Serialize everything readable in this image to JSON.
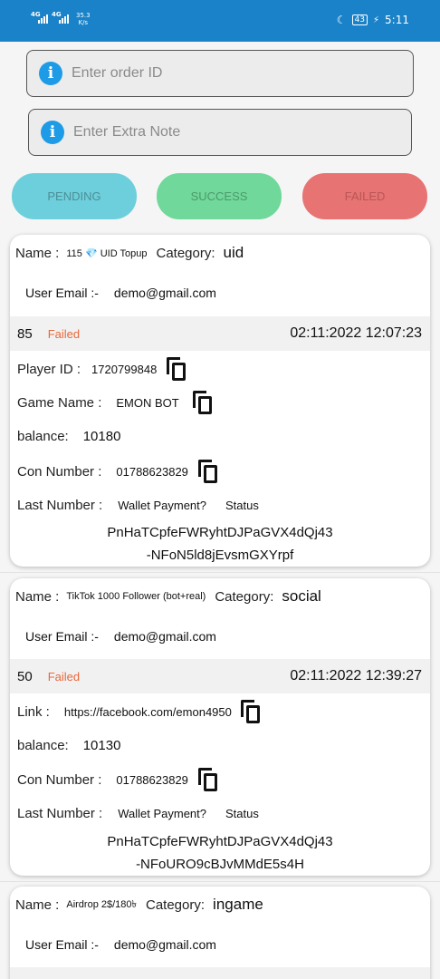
{
  "status_bar": {
    "network_1": "4G",
    "network_2": "4G",
    "speed_value": "35.3",
    "speed_unit": "K/s",
    "battery": "43",
    "time": "5:11"
  },
  "order_id_input": {
    "placeholder": "Enter order ID",
    "value": ""
  },
  "extra_note_input": {
    "placeholder": "Enter Extra Note",
    "value": ""
  },
  "filters": {
    "pending": "PENDING",
    "success": "SUCCESS",
    "failed": "FAILED"
  },
  "orders": [
    {
      "name_label": "Name :",
      "name": "115 💎 UID Topup",
      "category_label": "Category:",
      "category": "uid",
      "email_label": "User Email :-",
      "email": "demo@gmail.com",
      "amount": "85",
      "status": "Failed",
      "datetime": "02:11:2022 12:07:23",
      "player_id_label": "Player ID :",
      "player_id": "1720799848",
      "game_name_label": "Game Name :",
      "game_name": "EMON BOT",
      "balance_label": "balance:",
      "balance": "10180",
      "con_number_label": "Con Number :",
      "con_number": "01788623829",
      "last_number_label": "Last Number :",
      "wallet_payment": "Wallet Payment?",
      "status_label": "Status",
      "token_line1": "PnHaTCpfeFWRyhtDJPaGVX4dQj43",
      "token_line2": "-NFoN5ld8jEvsmGXYrpf"
    },
    {
      "name_label": "Name :",
      "name": "TikTok 1000 Follower (bot+real)",
      "category_label": "Category:",
      "category": "social",
      "email_label": "User Email :-",
      "email": "demo@gmail.com",
      "amount": "50",
      "status": "Failed",
      "datetime": "02:11:2022 12:39:27",
      "link_label": "Link :",
      "link": "https://facebook.com/emon4950",
      "balance_label": "balance:",
      "balance": "10130",
      "con_number_label": "Con Number :",
      "con_number": "01788623829",
      "last_number_label": "Last Number :",
      "wallet_payment": "Wallet Payment?",
      "status_label": "Status",
      "token_line1": "PnHaTCpfeFWRyhtDJPaGVX4dQj43",
      "token_line2": "-NFoURO9cBJvMMdE5s4H"
    },
    {
      "name_label": "Name :",
      "name": "Airdrop 2$/180৳",
      "category_label": "Category:",
      "category": "ingame",
      "email_label": "User Email :-",
      "email": "demo@gmail.com"
    }
  ]
}
